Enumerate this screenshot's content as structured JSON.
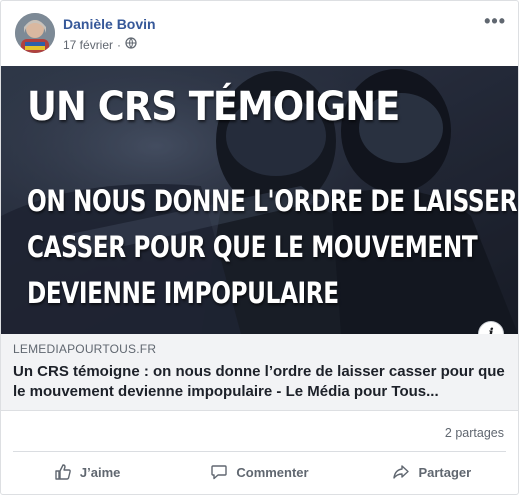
{
  "post": {
    "author": "Danièle Bovin",
    "date": "17 février",
    "separator": "·",
    "privacy_icon": "globe-icon",
    "more_icon": "more-horizontal-icon"
  },
  "preview": {
    "headline": "UN CRS TÉMOIGNE",
    "lines": [
      "ON NOUS DONNE L'ORDRE DE LAISSER",
      "CASSER POUR QUE LE MOUVEMENT",
      "DEVIENNE IMPOPULAIRE"
    ],
    "info_label": "i"
  },
  "link": {
    "domain": "LEMEDIAPOURTOUS.FR",
    "title": "Un CRS témoigne : on nous donne l’ordre de laisser casser pour que le mouvement devienne impopulaire - Le Média pour Tous..."
  },
  "stats": {
    "shares": "2 partages"
  },
  "actions": {
    "like": "J’aime",
    "comment": "Commenter",
    "share": "Partager"
  },
  "colors": {
    "author": "#365899",
    "muted": "#606770",
    "link_bg": "#f2f3f5"
  }
}
